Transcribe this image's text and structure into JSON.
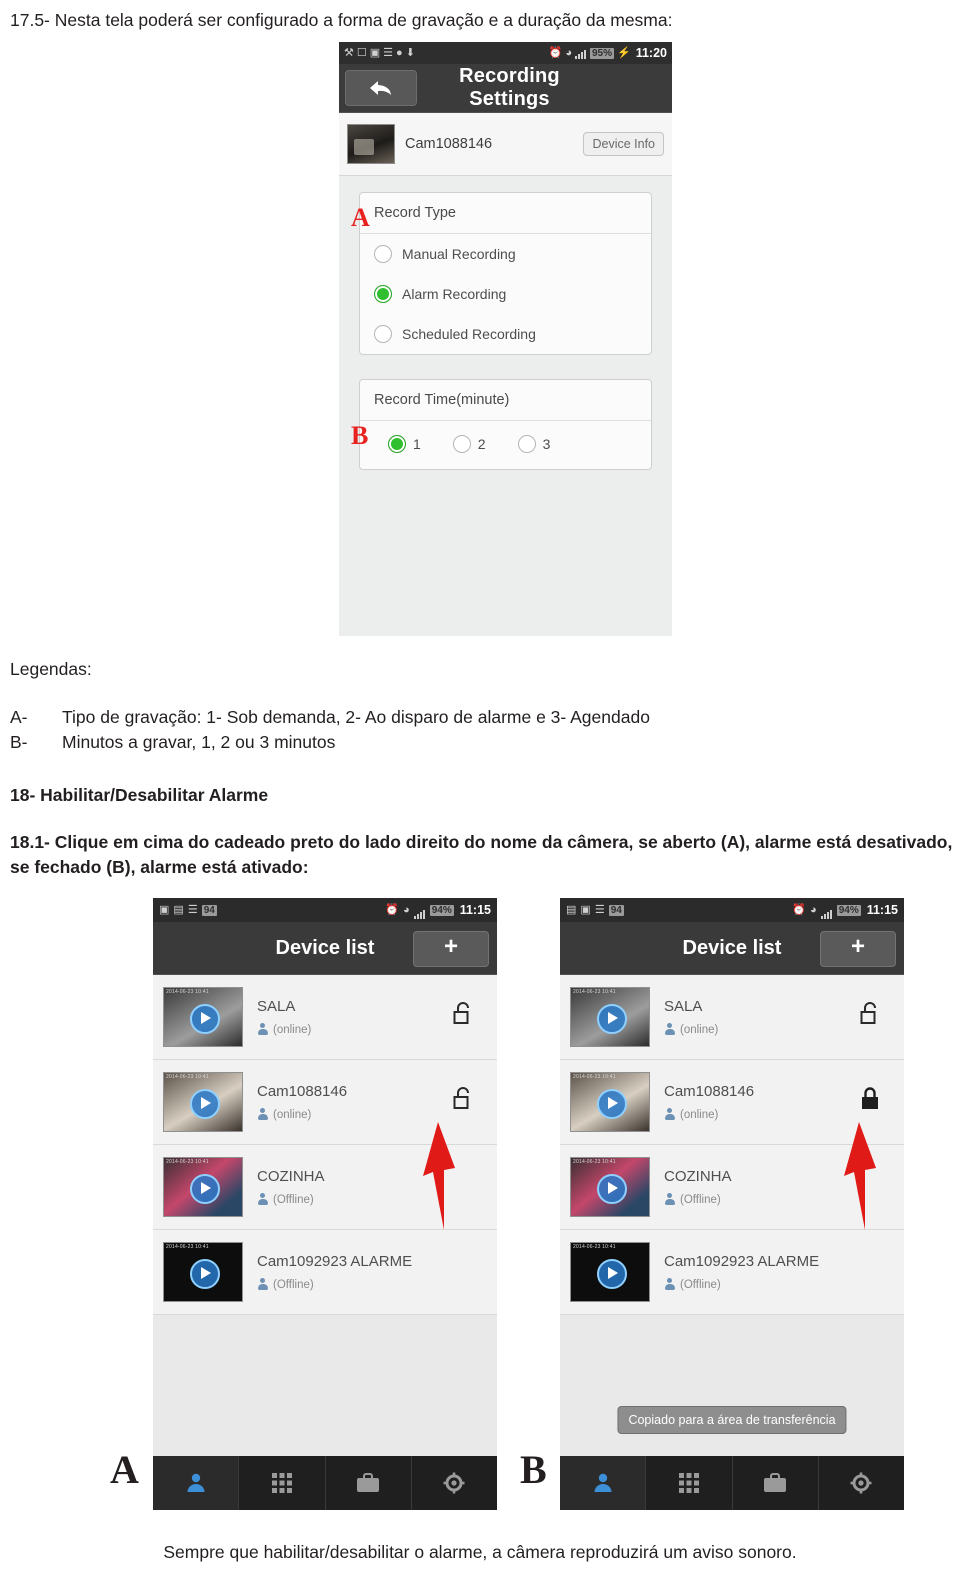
{
  "doc": {
    "para_1": "17.5- Nesta tela poderá ser configurado a forma de gravação e a duração da mesma:",
    "legend_title": "Legendas:",
    "legend": [
      {
        "key": "A-",
        "value": "Tipo de gravação: 1- Sob demanda, 2- Ao disparo de alarme e 3- Agendado"
      },
      {
        "key": "B-",
        "value": "Minutos a gravar, 1, 2 ou 3 minutos"
      }
    ],
    "section_18_title": "18- Habilitar/Desabilitar Alarme",
    "para_18_1": "18.1- Clique em cima do cadeado preto do lado direito do nome da câmera, se aberto (A), alarme está desativado, se fechado (B), alarme está ativado:",
    "footer_note": "Sempre que habilitar/desabilitar o alarme, a câmera reproduzirá um aviso sonoro."
  },
  "shot1": {
    "statusbar": {
      "battery": "95%",
      "time": "11:20"
    },
    "title": "Recording Settings",
    "camera_name": "Cam1088146",
    "device_info_button": "Device Info",
    "record_type": {
      "header": "Record Type",
      "marker": "A",
      "options": [
        {
          "label": "Manual Recording",
          "selected": false
        },
        {
          "label": "Alarm Recording",
          "selected": true
        },
        {
          "label": "Scheduled Recording",
          "selected": false
        }
      ]
    },
    "record_time": {
      "header": "Record Time(minute)",
      "marker": "B",
      "options": [
        {
          "label": "1",
          "selected": true
        },
        {
          "label": "2",
          "selected": false
        },
        {
          "label": "3",
          "selected": false
        }
      ]
    }
  },
  "shotA": {
    "marker": "A",
    "statusbar": {
      "battery": "94%",
      "time": "11:15"
    },
    "title": "Device list",
    "add_button": "+",
    "devices": [
      {
        "name": "SALA",
        "status": "(online)",
        "lock": "unlocked",
        "thumb_time": "2014-06-23  10:41"
      },
      {
        "name": "Cam1088146",
        "status": "(online)",
        "lock": "unlocked",
        "thumb_time": "2014-06-23  10:41"
      },
      {
        "name": "COZINHA",
        "status": "(Offline)",
        "lock": "none",
        "thumb_time": "2014-06-23  10:41"
      },
      {
        "name": "Cam1092923 ALARME",
        "status": "(Offline)",
        "lock": "none",
        "thumb_time": "2014-06-23  10:41"
      }
    ],
    "toast": "",
    "tabs": [
      "person-icon",
      "grid-icon",
      "briefcase-icon",
      "gear-icon"
    ]
  },
  "shotB": {
    "marker": "B",
    "statusbar": {
      "battery": "94%",
      "time": "11:15"
    },
    "title": "Device list",
    "add_button": "+",
    "devices": [
      {
        "name": "SALA",
        "status": "(online)",
        "lock": "unlocked",
        "thumb_time": "2014-06-23  10:41"
      },
      {
        "name": "Cam1088146",
        "status": "(online)",
        "lock": "locked",
        "thumb_time": "2014-06-23  10:41"
      },
      {
        "name": "COZINHA",
        "status": "(Offline)",
        "lock": "none",
        "thumb_time": "2014-06-23  10:41"
      },
      {
        "name": "Cam1092923 ALARME",
        "status": "(Offline)",
        "lock": "none",
        "thumb_time": "2014-06-23  10:41"
      }
    ],
    "toast": "Copiado para a área de transferência",
    "tabs": [
      "person-icon",
      "grid-icon",
      "briefcase-icon",
      "gear-icon"
    ]
  },
  "colors": {
    "marker_red": "#e8231f",
    "arrow_red": "#e01b17",
    "selected_green": "#2fbf2f",
    "tab_active_blue": "#3d8fd8"
  }
}
